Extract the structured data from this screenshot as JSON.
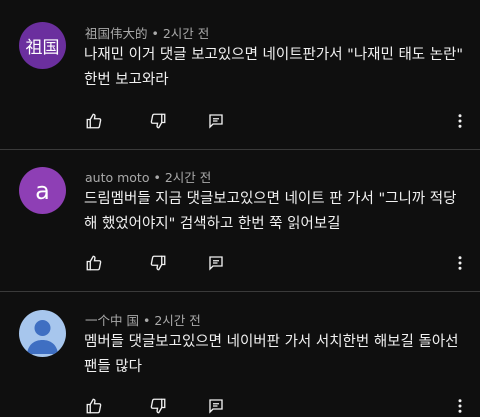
{
  "comments": [
    {
      "author": "祖国伟大的",
      "time": "2시간 전",
      "avatar_text": "祖国",
      "avatar_color": "#6b2f9e",
      "text": "나재민 이거 댓글 보고있으면 네이트판가서 \"나재민 태도 논란\" 한번 보고와라"
    },
    {
      "author": "auto moto",
      "time": "2시간 전",
      "avatar_text": "a",
      "avatar_color": "#8e3fb5",
      "text": "드림멤버들 지금 댓글보고있으면 네이트 판 가서 \"그니까 적당해 했었어야지\" 검색하고 한번 쭉 읽어보길"
    },
    {
      "author": "一个中 国",
      "time": "2시간 전",
      "avatar_text": "",
      "avatar_color": "#a7c6ed",
      "text": "멤버들 댓글보고있으면 네이버판 가서 서치한번 해보길 돌아선 팬들 많다"
    }
  ],
  "separator": "•",
  "icons": [
    "thumb-up-icon",
    "thumb-down-icon",
    "reply-icon",
    "more-vert-icon"
  ]
}
